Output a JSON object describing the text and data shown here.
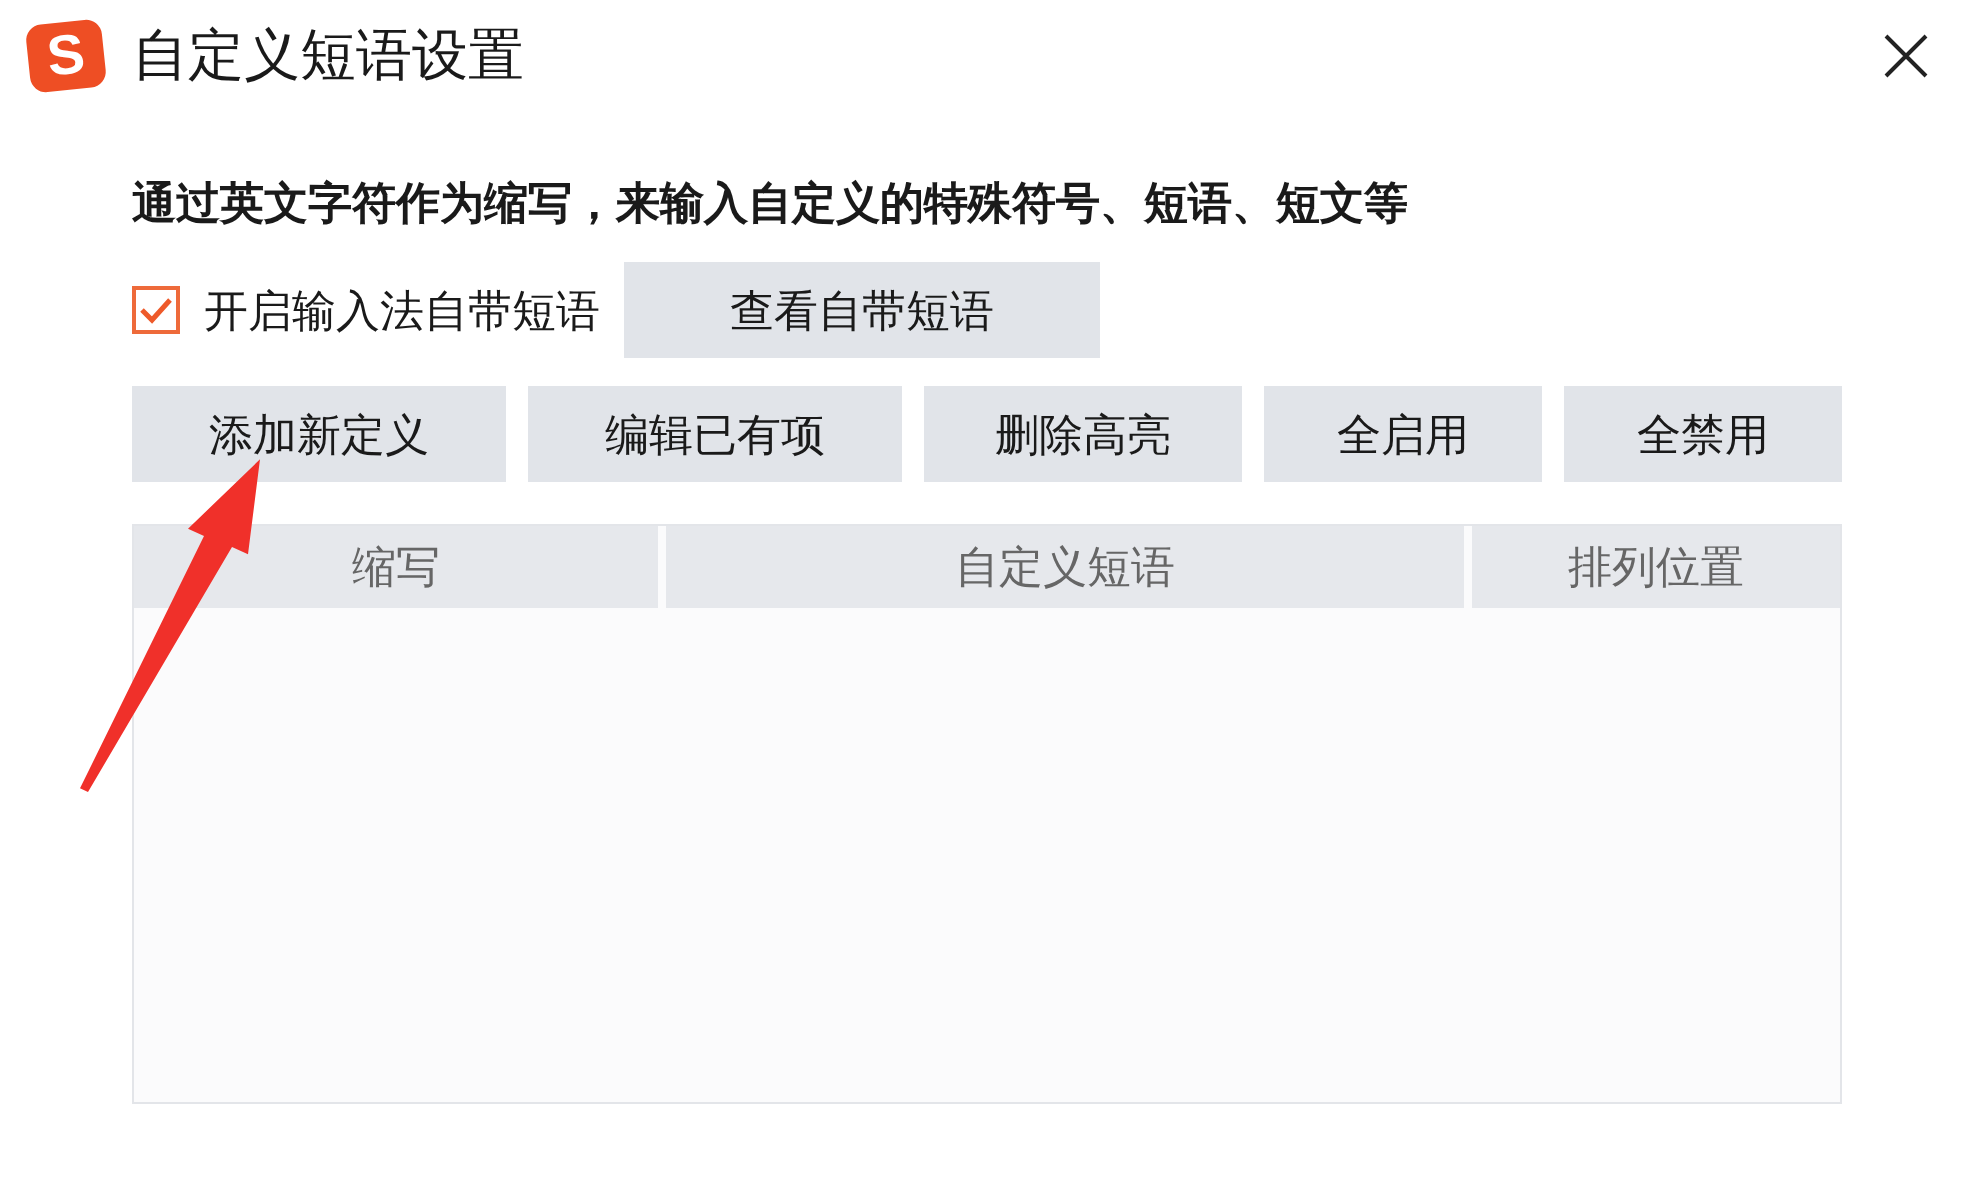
{
  "window": {
    "logo": "S",
    "title": "自定义短语设置"
  },
  "description": "通过英文字符作为缩写，来输入自定义的特殊符号、短语、短文等",
  "builtin_phrases": {
    "label": "开启输入法自带短语",
    "checked": true,
    "view_button": "查看自带短语"
  },
  "buttons": [
    "添加新定义",
    "编辑已有项",
    "删除高亮",
    "全启用",
    "全禁用"
  ],
  "table": {
    "columns": [
      "缩写",
      "自定义短语",
      "排列位置"
    ]
  }
}
